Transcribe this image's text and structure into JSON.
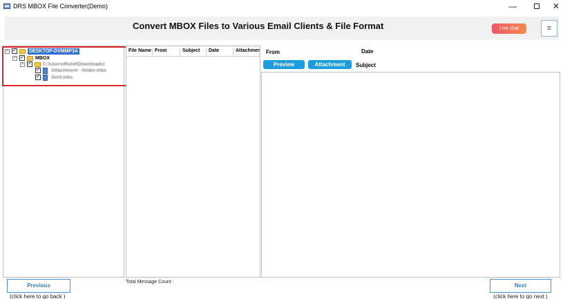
{
  "window": {
    "title": "DRS MBOX File Converter(Demo)",
    "minimize_glyph": "—",
    "close_glyph": "✕"
  },
  "header": {
    "title": "Convert MBOX Files to Various Email Clients & File Format",
    "live_chat_label": "Live chat",
    "menu_glyph": "≡"
  },
  "tree": {
    "items": [
      {
        "label": "DESKTOP-DVMMP3A",
        "checked": true,
        "selected": true,
        "icon": "computer-folder-icon"
      },
      {
        "label": "MBOX",
        "checked": true,
        "icon": "folder-icon"
      },
      {
        "label": "C:\\Users\\Rohit\\Downloads\\",
        "checked": true,
        "icon": "folder-icon"
      },
      {
        "label": "Attachment - folder.mbx",
        "checked": true,
        "icon": "mbox-file-icon"
      },
      {
        "label": "Sent.mbx",
        "checked": true,
        "icon": "mbox-file-icon"
      }
    ],
    "expander_minus": "−",
    "checkmark": "✓"
  },
  "message_list": {
    "columns": [
      "File Name",
      "From",
      "Subject",
      "Date",
      "Attachment"
    ]
  },
  "preview": {
    "from_label": "From",
    "date_label": "Date",
    "subject_label": "Subject",
    "preview_button": "Preview",
    "attachment_button": "Attachment"
  },
  "footer": {
    "total_count_label": "Total Message Count :",
    "previous_label": "Previous",
    "previous_hint": "(click here to  go back )",
    "next_label": "Next",
    "next_hint": "(click here to  go next )"
  },
  "colors": {
    "accent_blue": "#1e9ee0",
    "highlight_red": "#e0242b",
    "live_chat_start": "#f0566a",
    "live_chat_end": "#f58a4c"
  }
}
